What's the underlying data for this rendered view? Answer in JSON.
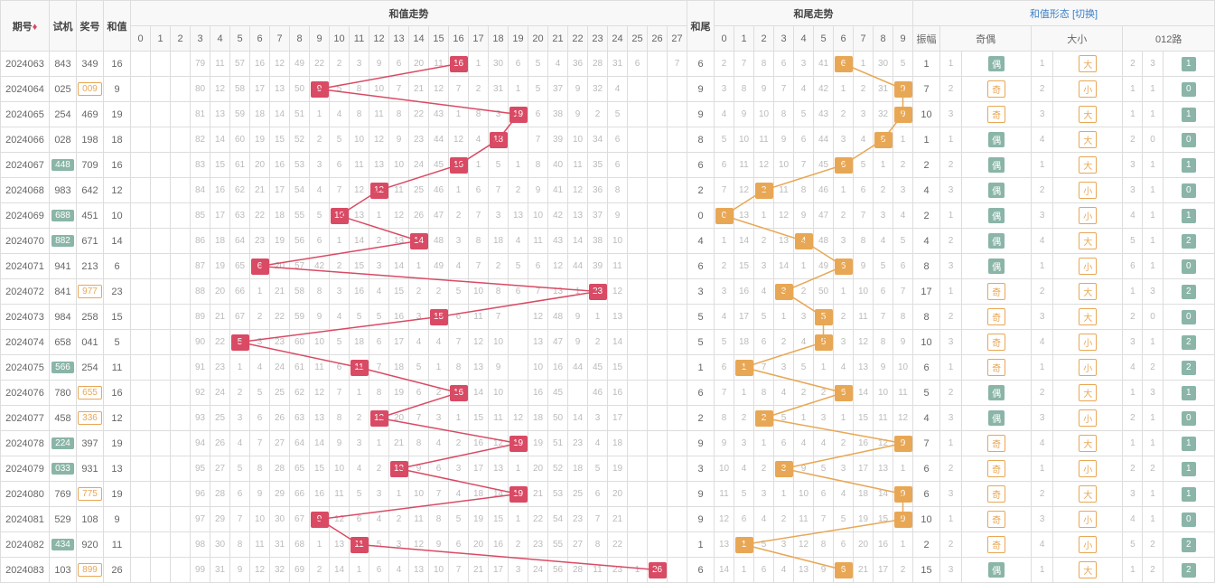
{
  "headers": {
    "period": "期号",
    "test": "试机",
    "prize": "奖号",
    "sum": "和值",
    "sum_trend": "和值走势",
    "tail": "和尾",
    "tail_trend": "和尾走势",
    "sum_form": "和值形态",
    "switch": "[切换]",
    "amp": "振幅",
    "parity": "奇偶",
    "size": "大小",
    "road": "012路"
  },
  "sum_cols": [
    0,
    1,
    2,
    3,
    4,
    5,
    6,
    7,
    8,
    9,
    10,
    11,
    12,
    13,
    14,
    15,
    16,
    17,
    18,
    19,
    20,
    21,
    22,
    23,
    24,
    25,
    26,
    27
  ],
  "tail_cols": [
    0,
    1,
    2,
    3,
    4,
    5,
    6,
    7,
    8,
    9
  ],
  "rows": [
    {
      "period": "2024063",
      "test": "843",
      "prize": "349",
      "sum": 16,
      "tail": 6,
      "amp": 1,
      "par": "偶",
      "size": "大",
      "road": 1,
      "th": false,
      "ph": false,
      "idx": 0,
      "sv": [
        null,
        null,
        null,
        79,
        11,
        57,
        16,
        12,
        49,
        22,
        2,
        3,
        9,
        6,
        20,
        11,
        16,
        1,
        30,
        6,
        5,
        4,
        36,
        28,
        31,
        6,
        null,
        7
      ],
      "tv": [
        2,
        7,
        8,
        6,
        3,
        41,
        6,
        1,
        30,
        5
      ],
      "r3": [
        2,
        3,
        1,
        1
      ]
    },
    {
      "period": "2024064",
      "test": "025",
      "prize": "009",
      "sum": 9,
      "tail": 9,
      "amp": 7,
      "par": "奇",
      "size": "小",
      "road": 0,
      "th": false,
      "ph": true,
      "idx": 1,
      "sv": [
        null,
        null,
        null,
        80,
        12,
        58,
        17,
        13,
        50,
        9,
        5,
        8,
        10,
        7,
        21,
        12,
        7,
        2,
        31,
        1,
        5,
        37,
        9,
        32,
        4,
        null,
        null,
        null
      ],
      "tv": [
        3,
        8,
        9,
        7,
        4,
        42,
        1,
        2,
        31,
        9
      ],
      "r3": [
        1,
        1,
        0,
        1,
        2
      ]
    },
    {
      "period": "2024065",
      "test": "254",
      "prize": "469",
      "sum": 19,
      "tail": 9,
      "amp": 10,
      "par": "奇",
      "size": "大",
      "road": 1,
      "th": false,
      "ph": false,
      "idx": 2,
      "sv": [
        null,
        null,
        null,
        81,
        13,
        59,
        18,
        14,
        51,
        1,
        4,
        8,
        11,
        8,
        22,
        43,
        1,
        8,
        3,
        19,
        6,
        38,
        9,
        2,
        5,
        null,
        null,
        null
      ],
      "tv": [
        4,
        9,
        10,
        8,
        5,
        43,
        2,
        3,
        32,
        9
      ],
      "r3": [
        1,
        1,
        1,
        3
      ]
    },
    {
      "period": "2024066",
      "test": "028",
      "prize": "198",
      "sum": 18,
      "tail": 8,
      "amp": 1,
      "par": "偶",
      "size": "大",
      "road": 0,
      "th": false,
      "ph": false,
      "idx": 3,
      "sv": [
        null,
        null,
        null,
        82,
        14,
        60,
        19,
        15,
        52,
        2,
        5,
        10,
        12,
        9,
        23,
        44,
        12,
        4,
        18,
        null,
        7,
        39,
        10,
        34,
        6,
        null,
        null,
        null
      ],
      "tv": [
        5,
        10,
        11,
        9,
        6,
        44,
        3,
        4,
        8,
        1
      ],
      "r3": [
        2,
        0,
        1,
        4
      ]
    },
    {
      "period": "2024067",
      "test": "448",
      "prize": "709",
      "sum": 16,
      "tail": 6,
      "amp": 2,
      "par": "偶",
      "size": "大",
      "road": 1,
      "th": true,
      "ph": false,
      "idx": 4,
      "sv": [
        null,
        null,
        null,
        83,
        15,
        61,
        20,
        16,
        53,
        3,
        6,
        11,
        13,
        10,
        24,
        45,
        16,
        1,
        5,
        1,
        8,
        40,
        11,
        35,
        6,
        null,
        null,
        null
      ],
      "tv": [
        6,
        11,
        12,
        10,
        7,
        45,
        6,
        5,
        1,
        2
      ],
      "r3": [
        3,
        1,
        1,
        5
      ]
    },
    {
      "period": "2024068",
      "test": "983",
      "prize": "642",
      "sum": 12,
      "tail": 2,
      "amp": 4,
      "par": "偶",
      "size": "小",
      "road": 0,
      "th": false,
      "ph": false,
      "idx": 5,
      "sv": [
        null,
        null,
        null,
        84,
        16,
        62,
        21,
        17,
        54,
        4,
        7,
        12,
        12,
        11,
        25,
        46,
        1,
        6,
        7,
        2,
        9,
        41,
        12,
        36,
        8,
        null,
        null,
        null
      ],
      "tv": [
        7,
        12,
        2,
        11,
        8,
        46,
        1,
        6,
        2,
        3
      ],
      "r3": [
        3,
        1,
        0,
        1,
        6
      ]
    },
    {
      "period": "2024069",
      "test": "688",
      "prize": "451",
      "sum": 10,
      "tail": 0,
      "amp": 2,
      "par": "偶",
      "size": "小",
      "road": 1,
      "th": true,
      "ph": false,
      "idx": 6,
      "sv": [
        null,
        null,
        null,
        85,
        17,
        63,
        22,
        18,
        55,
        5,
        10,
        13,
        1,
        12,
        26,
        47,
        2,
        7,
        3,
        13,
        10,
        42,
        13,
        37,
        9,
        null,
        null,
        null
      ],
      "tv": [
        0,
        13,
        1,
        12,
        9,
        47,
        2,
        7,
        3,
        4
      ],
      "r3": [
        4,
        1,
        1,
        7
      ]
    },
    {
      "period": "2024070",
      "test": "882",
      "prize": "671",
      "sum": 14,
      "tail": 4,
      "amp": 4,
      "par": "偶",
      "size": "大",
      "road": 2,
      "th": true,
      "ph": false,
      "idx": 7,
      "sv": [
        null,
        null,
        null,
        86,
        18,
        64,
        23,
        19,
        56,
        6,
        1,
        14,
        2,
        13,
        14,
        48,
        3,
        8,
        18,
        4,
        11,
        43,
        14,
        38,
        10,
        null,
        null,
        null
      ],
      "tv": [
        1,
        14,
        2,
        13,
        4,
        48,
        3,
        8,
        4,
        5
      ],
      "r3": [
        5,
        1,
        1,
        2
      ]
    },
    {
      "period": "2024071",
      "test": "941",
      "prize": "213",
      "sum": 6,
      "tail": 6,
      "amp": 8,
      "par": "偶",
      "size": "小",
      "road": 0,
      "th": false,
      "ph": false,
      "idx": 8,
      "sv": [
        null,
        null,
        null,
        87,
        19,
        65,
        6,
        20,
        57,
        42,
        2,
        15,
        3,
        14,
        1,
        49,
        4,
        7,
        2,
        5,
        6,
        12,
        44,
        39,
        11,
        null,
        null,
        null
      ],
      "tv": [
        2,
        15,
        3,
        14,
        1,
        49,
        6,
        9,
        5,
        6
      ],
      "r3": [
        6,
        1,
        0,
        2
      ]
    },
    {
      "period": "2024072",
      "test": "841",
      "prize": "977",
      "sum": 23,
      "tail": 3,
      "amp": 17,
      "par": "奇",
      "size": "大",
      "road": 2,
      "th": false,
      "ph": true,
      "idx": 9,
      "sv": [
        null,
        null,
        null,
        88,
        20,
        66,
        1,
        21,
        58,
        8,
        3,
        16,
        4,
        15,
        2,
        2,
        5,
        10,
        8,
        6,
        7,
        13,
        1,
        23,
        12,
        null,
        null,
        null
      ],
      "tv": [
        3,
        16,
        4,
        3,
        2,
        50,
        1,
        10,
        6,
        7
      ],
      "r3": [
        1,
        3,
        2
      ]
    },
    {
      "period": "2024073",
      "test": "984",
      "prize": "258",
      "sum": 15,
      "tail": 5,
      "amp": 8,
      "par": "奇",
      "size": "大",
      "road": 0,
      "th": false,
      "ph": false,
      "idx": 10,
      "sv": [
        null,
        null,
        null,
        89,
        21,
        67,
        2,
        22,
        59,
        9,
        4,
        5,
        5,
        16,
        3,
        15,
        6,
        11,
        7,
        null,
        12,
        48,
        9,
        1,
        13,
        null,
        null,
        null
      ],
      "tv": [
        4,
        17,
        5,
        1,
        3,
        5,
        2,
        11,
        7,
        8
      ],
      "r3": [
        2,
        0,
        4,
        1
      ]
    },
    {
      "period": "2024074",
      "test": "658",
      "prize": "041",
      "sum": 5,
      "tail": 5,
      "amp": 10,
      "par": "奇",
      "size": "小",
      "road": 2,
      "th": false,
      "ph": false,
      "idx": 11,
      "sv": [
        null,
        null,
        null,
        90,
        22,
        5,
        3,
        23,
        60,
        10,
        5,
        18,
        6,
        17,
        4,
        4,
        7,
        12,
        10,
        null,
        13,
        47,
        9,
        2,
        14,
        null,
        null,
        null
      ],
      "tv": [
        5,
        18,
        6,
        2,
        4,
        5,
        3,
        12,
        8,
        9
      ],
      "r3": [
        3,
        1,
        1,
        5,
        2
      ]
    },
    {
      "period": "2024075",
      "test": "566",
      "prize": "254",
      "sum": 11,
      "tail": 1,
      "amp": 6,
      "par": "奇",
      "size": "小",
      "road": 2,
      "th": true,
      "ph": false,
      "idx": 12,
      "sv": [
        null,
        null,
        null,
        91,
        23,
        1,
        4,
        24,
        61,
        11,
        6,
        11,
        7,
        18,
        5,
        1,
        8,
        13,
        9,
        null,
        10,
        16,
        44,
        45,
        15,
        null,
        null,
        null
      ],
      "tv": [
        6,
        1,
        7,
        3,
        5,
        1,
        4,
        13,
        9,
        10
      ],
      "r3": [
        4,
        2,
        2,
        6,
        2
      ]
    },
    {
      "period": "2024076",
      "test": "780",
      "prize": "655",
      "sum": 16,
      "tail": 6,
      "amp": 5,
      "par": "偶",
      "size": "大",
      "road": 1,
      "th": false,
      "ph": true,
      "idx": 13,
      "sv": [
        null,
        null,
        null,
        92,
        24,
        2,
        5,
        25,
        62,
        12,
        7,
        1,
        8,
        19,
        6,
        2,
        16,
        14,
        10,
        null,
        16,
        45,
        null,
        46,
        16,
        null,
        null,
        null
      ],
      "tv": [
        7,
        1,
        8,
        4,
        2,
        2,
        6,
        14,
        10,
        11
      ],
      "r3": [
        1,
        3,
        1,
        1
      ]
    },
    {
      "period": "2024077",
      "test": "458",
      "prize": "336",
      "sum": 12,
      "tail": 2,
      "amp": 4,
      "par": "偶",
      "size": "小",
      "road": 0,
      "th": false,
      "ph": true,
      "idx": 14,
      "sv": [
        null,
        null,
        null,
        93,
        25,
        3,
        6,
        26,
        63,
        13,
        8,
        2,
        12,
        20,
        7,
        3,
        1,
        15,
        11,
        12,
        18,
        50,
        14,
        3,
        17,
        null,
        null,
        null
      ],
      "tv": [
        8,
        2,
        2,
        5,
        1,
        3,
        1,
        15,
        11,
        12
      ],
      "r3": [
        2,
        1,
        0,
        1,
        2
      ]
    },
    {
      "period": "2024078",
      "test": "224",
      "prize": "397",
      "sum": 19,
      "tail": 9,
      "amp": 7,
      "par": "奇",
      "size": "大",
      "road": 1,
      "th": true,
      "ph": false,
      "idx": 15,
      "sv": [
        null,
        null,
        null,
        94,
        26,
        4,
        7,
        27,
        64,
        14,
        9,
        3,
        1,
        21,
        8,
        4,
        2,
        16,
        12,
        19,
        19,
        51,
        23,
        4,
        18,
        null,
        null,
        null
      ],
      "tv": [
        9,
        3,
        1,
        6,
        4,
        4,
        2,
        16,
        12,
        9
      ],
      "r3": [
        1,
        1,
        1,
        3
      ]
    },
    {
      "period": "2024079",
      "test": "033",
      "prize": "931",
      "sum": 13,
      "tail": 3,
      "amp": 6,
      "par": "奇",
      "size": "小",
      "road": 1,
      "th": true,
      "ph": false,
      "idx": 16,
      "sv": [
        null,
        null,
        null,
        95,
        27,
        5,
        8,
        28,
        65,
        15,
        10,
        4,
        2,
        13,
        9,
        6,
        3,
        17,
        13,
        1,
        20,
        52,
        18,
        5,
        19,
        null,
        null,
        null
      ],
      "tv": [
        10,
        4,
        2,
        3,
        9,
        5,
        3,
        17,
        13,
        1
      ],
      "r3": [
        2,
        2,
        1,
        4
      ]
    },
    {
      "period": "2024080",
      "test": "769",
      "prize": "775",
      "sum": 19,
      "tail": 9,
      "amp": 6,
      "par": "奇",
      "size": "大",
      "road": 1,
      "th": false,
      "ph": true,
      "idx": 17,
      "sv": [
        null,
        null,
        null,
        96,
        28,
        6,
        9,
        29,
        66,
        16,
        11,
        5,
        3,
        1,
        10,
        7,
        4,
        18,
        14,
        19,
        21,
        53,
        25,
        6,
        20,
        null,
        null,
        null
      ],
      "tv": [
        11,
        5,
        3,
        1,
        10,
        6,
        4,
        18,
        14,
        9
      ],
      "r3": [
        3,
        1,
        3,
        1,
        5
      ]
    },
    {
      "period": "2024081",
      "test": "529",
      "prize": "108",
      "sum": 9,
      "tail": 9,
      "amp": 10,
      "par": "奇",
      "size": "小",
      "road": 0,
      "th": false,
      "ph": false,
      "idx": 18,
      "sv": [
        null,
        null,
        null,
        97,
        29,
        7,
        10,
        30,
        67,
        9,
        12,
        6,
        4,
        2,
        11,
        8,
        5,
        19,
        15,
        1,
        22,
        54,
        23,
        7,
        21,
        null,
        null,
        null
      ],
      "tv": [
        12,
        6,
        4,
        2,
        11,
        7,
        5,
        19,
        15,
        9
      ],
      "r3": [
        4,
        1,
        0,
        1
      ]
    },
    {
      "period": "2024082",
      "test": "434",
      "prize": "920",
      "sum": 11,
      "tail": 1,
      "amp": 2,
      "par": "奇",
      "size": "小",
      "road": 2,
      "th": true,
      "ph": false,
      "idx": 19,
      "sv": [
        null,
        null,
        null,
        98,
        30,
        8,
        11,
        31,
        68,
        1,
        13,
        11,
        5,
        3,
        12,
        9,
        6,
        20,
        16,
        2,
        23,
        55,
        27,
        8,
        22,
        null,
        null,
        null
      ],
      "tv": [
        13,
        1,
        5,
        3,
        12,
        8,
        6,
        20,
        16,
        1
      ],
      "r3": [
        5,
        2,
        1,
        2,
        2
      ]
    },
    {
      "period": "2024083",
      "test": "103",
      "prize": "899",
      "sum": 26,
      "tail": 6,
      "amp": 15,
      "par": "偶",
      "size": "大",
      "road": 2,
      "th": false,
      "ph": true,
      "idx": 20,
      "sv": [
        null,
        null,
        null,
        99,
        31,
        9,
        12,
        32,
        69,
        2,
        14,
        1,
        6,
        4,
        13,
        10,
        7,
        21,
        17,
        3,
        24,
        56,
        28,
        11,
        23,
        1,
        26,
        null
      ],
      "tv": [
        14,
        1,
        6,
        4,
        13,
        9,
        6,
        21,
        17,
        2
      ],
      "r3": [
        1,
        2,
        3,
        2
      ]
    }
  ],
  "chart_data": {
    "type": "line",
    "title": "和值走势 / 和尾走势",
    "series": [
      {
        "name": "和值",
        "x": [
          "2024063",
          "2024064",
          "2024065",
          "2024066",
          "2024067",
          "2024068",
          "2024069",
          "2024070",
          "2024071",
          "2024072",
          "2024073",
          "2024074",
          "2024075",
          "2024076",
          "2024077",
          "2024078",
          "2024079",
          "2024080",
          "2024081",
          "2024082",
          "2024083"
        ],
        "values": [
          16,
          9,
          19,
          18,
          16,
          12,
          10,
          14,
          6,
          23,
          15,
          5,
          11,
          16,
          12,
          19,
          13,
          19,
          9,
          11,
          26
        ]
      },
      {
        "name": "和尾",
        "x": [
          "2024063",
          "2024064",
          "2024065",
          "2024066",
          "2024067",
          "2024068",
          "2024069",
          "2024070",
          "2024071",
          "2024072",
          "2024073",
          "2024074",
          "2024075",
          "2024076",
          "2024077",
          "2024078",
          "2024079",
          "2024080",
          "2024081",
          "2024082",
          "2024083"
        ],
        "values": [
          6,
          9,
          9,
          8,
          6,
          2,
          0,
          4,
          6,
          3,
          5,
          5,
          1,
          6,
          2,
          9,
          3,
          9,
          9,
          1,
          6
        ]
      }
    ],
    "xlabel": "期号",
    "ylabel": "值",
    "ylim": [
      0,
      27
    ]
  }
}
